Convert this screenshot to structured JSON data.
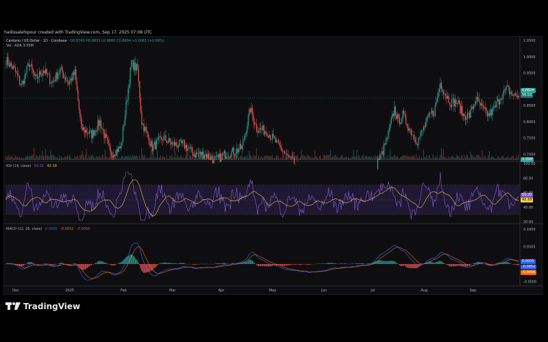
{
  "header": {
    "credit": "hadissalehipour created with TradingView.com, Sep 17, 2025 07:08 UTC"
  },
  "legend": {
    "symbol": "Cardano / US Dollar · 1D · Coinbase",
    "ohlc": "O0.8742  H0.8833  L0.8660  C0.8804  +0.0061 (+0.69%)",
    "volume": "Vol · ADA  3.35M",
    "rsi_label": "RSI (14, close)",
    "rsi_value1": "50.26",
    "rsi_value2": "42.18",
    "macd_label": "MACD (12, 26, close)",
    "macd_value1": "0.0005",
    "macd_value2": "-0.0052",
    "macd_value3": "-0.0056"
  },
  "brand": {
    "name": "TradingView"
  },
  "colors": {
    "up": "#26a69a",
    "down": "#ef5350",
    "rsi": "#7e57c2",
    "rsi_ma": "#f7c948",
    "macd": "#2962ff",
    "signal": "#ff6d00",
    "rsi_band": "#2a1f4a"
  },
  "price_tags": {
    "last": "0.8824",
    "last_sub": "56:52",
    "vol": "3.35M"
  },
  "rsi_tags": {
    "a": "50.20",
    "b": "42.18"
  },
  "macd_tags": {
    "a": "0.0005",
    "b": "-0.0052",
    "c": "-0.0056"
  },
  "chart_data": [
    {
      "type": "candlestick",
      "title": "Cardano / US Dollar · 1D · Coinbase",
      "y_ticks": [
        "1.0500",
        "1.0000",
        "0.9500",
        "0.9000",
        "0.8500",
        "0.8000",
        "0.7500",
        "0.7000"
      ],
      "ylim": [
        0.6818,
        1.0526
      ],
      "x_ticks": [
        "Dec",
        "2025",
        "Feb",
        "Mar",
        "Apr",
        "May",
        "Jun",
        "Jul",
        "Aug",
        "Sep"
      ],
      "close_anchor_points": [
        [
          0,
          0.99
        ],
        [
          8,
          0.96
        ],
        [
          15,
          0.91
        ],
        [
          22,
          0.98
        ],
        [
          28,
          0.93
        ],
        [
          36,
          0.96
        ],
        [
          44,
          0.92
        ],
        [
          52,
          0.96
        ],
        [
          60,
          0.92
        ],
        [
          66,
          0.95
        ],
        [
          72,
          0.78
        ],
        [
          82,
          0.76
        ],
        [
          90,
          0.8
        ],
        [
          100,
          0.7
        ],
        [
          110,
          0.72
        ],
        [
          120,
          0.98
        ],
        [
          126,
          0.96
        ],
        [
          130,
          0.8
        ],
        [
          140,
          0.72
        ],
        [
          150,
          0.75
        ],
        [
          160,
          0.73
        ],
        [
          170,
          0.73
        ],
        [
          180,
          0.7
        ],
        [
          190,
          0.7
        ],
        [
          200,
          0.68
        ],
        [
          210,
          0.7
        ],
        [
          220,
          0.71
        ],
        [
          226,
          0.72
        ],
        [
          234,
          0.84
        ],
        [
          240,
          0.78
        ],
        [
          250,
          0.77
        ],
        [
          260,
          0.73
        ],
        [
          270,
          0.69
        ],
        [
          280,
          0.66
        ],
        [
          290,
          0.62
        ],
        [
          300,
          0.6
        ],
        [
          310,
          0.6
        ],
        [
          320,
          0.59
        ],
        [
          330,
          0.58
        ],
        [
          340,
          0.58
        ],
        [
          350,
          0.6
        ],
        [
          356,
          0.68
        ],
        [
          360,
          0.7
        ],
        [
          366,
          0.76
        ],
        [
          372,
          0.84
        ],
        [
          376,
          0.8
        ],
        [
          380,
          0.82
        ],
        [
          386,
          0.78
        ],
        [
          394,
          0.74
        ],
        [
          400,
          0.78
        ],
        [
          406,
          0.82
        ],
        [
          410,
          0.83
        ],
        [
          416,
          0.92
        ],
        [
          420,
          0.89
        ],
        [
          426,
          0.86
        ],
        [
          432,
          0.86
        ],
        [
          438,
          0.82
        ],
        [
          444,
          0.82
        ],
        [
          450,
          0.87
        ],
        [
          456,
          0.84
        ],
        [
          462,
          0.82
        ],
        [
          468,
          0.84
        ],
        [
          474,
          0.88
        ],
        [
          480,
          0.9
        ],
        [
          486,
          0.88
        ],
        [
          491,
          0.88
        ]
      ],
      "volume_label": "3.35M"
    },
    {
      "type": "line",
      "title": "RSI (14, close)",
      "y_ticks": [
        "100.00",
        "80.00",
        "60.00",
        "40.00",
        "20.00"
      ],
      "ylim": [
        20,
        100
      ],
      "band": [
        30,
        70
      ],
      "series": [
        {
          "name": "RSI",
          "last": 50.26
        },
        {
          "name": "RSI MA",
          "last": 42.18
        }
      ]
    },
    {
      "type": "line",
      "title": "MACD (12, 26, close)",
      "y_ticks": [
        "0.1000",
        "0.0500",
        "-0.0500"
      ],
      "ylim": [
        -0.055,
        0.11
      ],
      "series": [
        {
          "name": "MACD",
          "last": 0.0005
        },
        {
          "name": "Signal",
          "last": -0.0052
        },
        {
          "name": "Histogram",
          "last": -0.0056
        }
      ]
    }
  ]
}
